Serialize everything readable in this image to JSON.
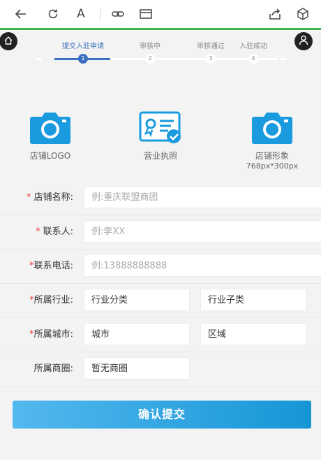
{
  "steps": [
    {
      "label": "提交入驻申请",
      "number": "1",
      "active": true
    },
    {
      "label": "审核中",
      "number": "2",
      "active": false
    },
    {
      "label": "审核通过",
      "number": "3",
      "active": false
    },
    {
      "label": "入驻成功",
      "number": "4",
      "active": false
    }
  ],
  "uploads": {
    "logo": {
      "label": "店铺LOGO"
    },
    "license": {
      "label": "营业执照"
    },
    "banner": {
      "label": "店铺形象",
      "sub": "768px*300px"
    }
  },
  "form": {
    "shop_name": {
      "star": "*",
      "label": "店铺名称:",
      "placeholder": "例:重庆联盟商团"
    },
    "contact": {
      "star": "*",
      "label": "联系人:",
      "placeholder": "例:李XX"
    },
    "phone": {
      "star": "*",
      "label": "联系电话:",
      "placeholder": "例:13888888888"
    },
    "industry": {
      "star": "*",
      "label": "所属行业:",
      "category": "行业分类",
      "subcategory": "行业子类"
    },
    "city": {
      "star": "*",
      "label": "所属城市:",
      "city": "城市",
      "district": "区域"
    },
    "district": {
      "label": "所属商圈:",
      "value": "暂无商圈"
    }
  },
  "submit_label": "确认提交",
  "colors": {
    "accent": "#3b6fbf",
    "brand_green": "#3bb54a",
    "submit_start": "#53b8ee",
    "submit_end": "#1696d6",
    "icon_blue": "#1a9be0",
    "required": "#e53935"
  }
}
